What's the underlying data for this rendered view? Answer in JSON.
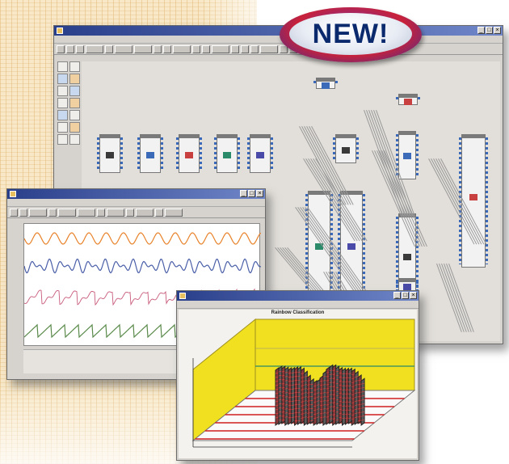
{
  "badge": {
    "text": "NEW!"
  },
  "colors": {
    "badge_ring": "#c9213a",
    "badge_text": "#0b2a6e",
    "titlebar": "#2a3f8a",
    "plot_series_1": "#e8822a",
    "plot_series_2": "#4a5fa8",
    "plot_series_3": "#c85a7a",
    "plot_series_4": "#5a8a4a",
    "surface_wall": "#f0e020",
    "surface_lines": "#d02020"
  },
  "main_window": {
    "window_controls": {
      "minimize": "_",
      "maximize": "□",
      "close": "×"
    },
    "palette_icons": [
      "signal-source-icon",
      "filter-icon",
      "plot-icon",
      "fft-icon",
      "gain-icon",
      "switch-icon",
      "math-icon",
      "file-icon",
      "trigger-icon",
      "probe-icon",
      "network-icon",
      "display-icon",
      "matrix-icon",
      "grid-icon"
    ]
  },
  "plot_window": {
    "window_controls": {
      "minimize": "_",
      "maximize": "□",
      "close": "×"
    },
    "series": [
      "orange-sine",
      "blue-chirp",
      "pink-sawtooth",
      "green-sawtooth"
    ]
  },
  "viewer_window": {
    "window_controls": {
      "minimize": "_",
      "maximize": "□",
      "close": "×"
    },
    "chart_title": "Rainbow Classification"
  }
}
